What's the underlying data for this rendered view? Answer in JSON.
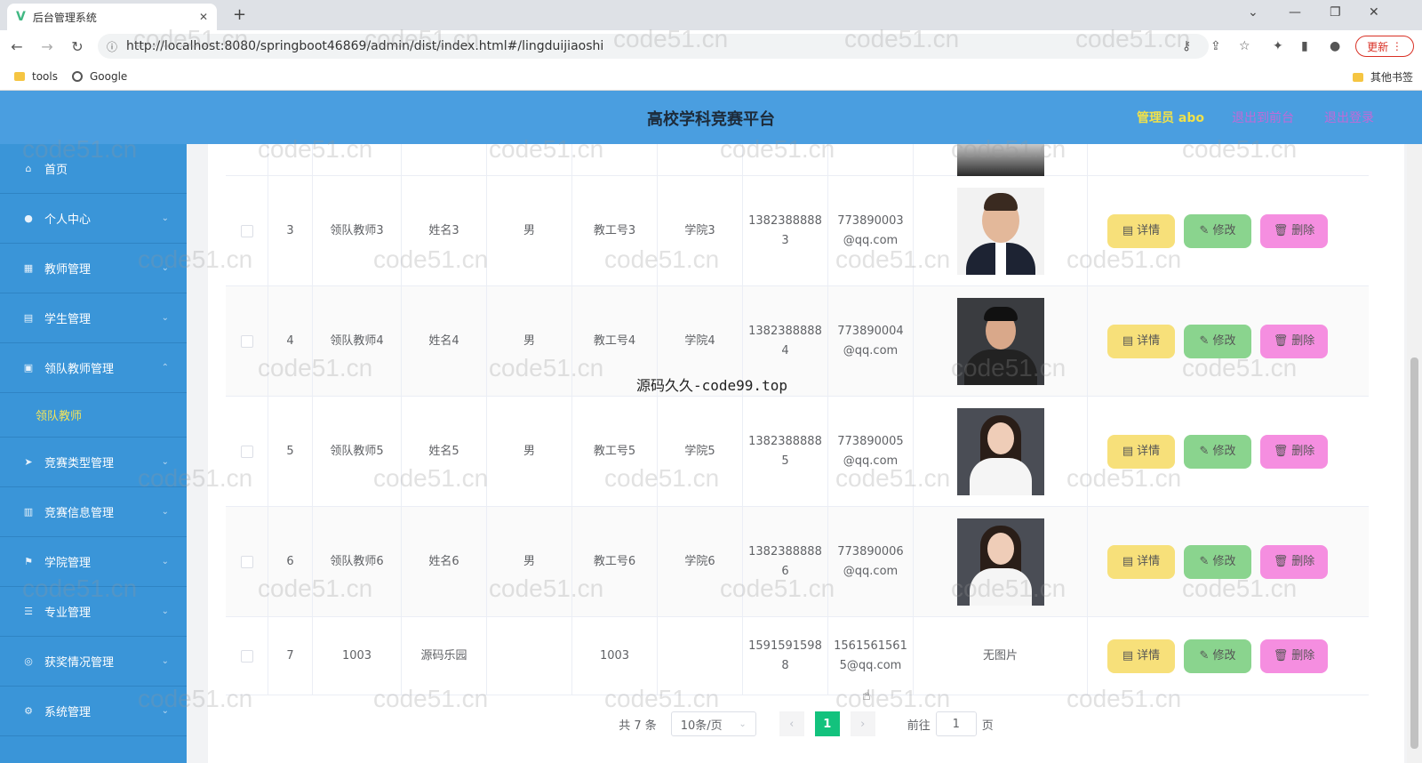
{
  "browser": {
    "tab_title": "后台管理系统",
    "url": "http://localhost:8080/springboot46869/admin/dist/index.html#/lingduijiaoshi",
    "update_label": "更新",
    "bookmarks": [
      "tools",
      "Google"
    ],
    "other_bookmarks": "其他书签"
  },
  "header": {
    "title": "高校学科竞赛平台",
    "user": "管理员 abo",
    "links": [
      "退出到前台",
      "退出登录"
    ]
  },
  "sidebar": {
    "items": [
      {
        "label": "首页",
        "icon": "home-icon"
      },
      {
        "label": "个人中心",
        "icon": "user-icon"
      },
      {
        "label": "教师管理",
        "icon": "grid-icon"
      },
      {
        "label": "学生管理",
        "icon": "table-icon"
      },
      {
        "label": "领队教师管理",
        "icon": "gift-icon"
      }
    ],
    "active_sub": "领队教师",
    "items_after": [
      {
        "label": "竞赛类型管理",
        "icon": "send-icon"
      },
      {
        "label": "竞赛信息管理",
        "icon": "chart-icon"
      },
      {
        "label": "学院管理",
        "icon": "flag-icon"
      },
      {
        "label": "专业管理",
        "icon": "list-icon"
      },
      {
        "label": "获奖情况管理",
        "icon": "globe-icon"
      },
      {
        "label": "系统管理",
        "icon": "settings-icon"
      }
    ]
  },
  "table": {
    "rows": [
      {
        "idx": "3",
        "account": "领队教师3",
        "name": "姓名3",
        "sex": "男",
        "staff_no": "教工号3",
        "college": "学院3",
        "phone": "13823888883",
        "email": "773890003@qq.com",
        "photo": "photo"
      },
      {
        "idx": "4",
        "account": "领队教师4",
        "name": "姓名4",
        "sex": "男",
        "staff_no": "教工号4",
        "college": "学院4",
        "phone": "13823888884",
        "email": "773890004@qq.com",
        "photo": "photo"
      },
      {
        "idx": "5",
        "account": "领队教师5",
        "name": "姓名5",
        "sex": "男",
        "staff_no": "教工号5",
        "college": "学院5",
        "phone": "13823888885",
        "email": "773890005@qq.com",
        "photo": "photo"
      },
      {
        "idx": "6",
        "account": "领队教师6",
        "name": "姓名6",
        "sex": "男",
        "staff_no": "教工号6",
        "college": "学院6",
        "phone": "13823888886",
        "email": "773890006@qq.com",
        "photo": "photo"
      },
      {
        "idx": "7",
        "account": "1003",
        "name": "源码乐园",
        "sex": "",
        "staff_no": "1003",
        "college": "",
        "phone": "15915915988",
        "email": "15615615615@qq.com",
        "photo": "无图片"
      }
    ],
    "actions": {
      "detail": "详情",
      "edit": "修改",
      "delete": "删除"
    }
  },
  "pagination": {
    "total": "共 7 条",
    "page_size": "10条/页",
    "current": "1",
    "goto_prefix": "前往",
    "goto_value": "1",
    "goto_suffix": "页"
  },
  "overlay_text": "源码久久-code99.top",
  "watermark": "code51.cn"
}
